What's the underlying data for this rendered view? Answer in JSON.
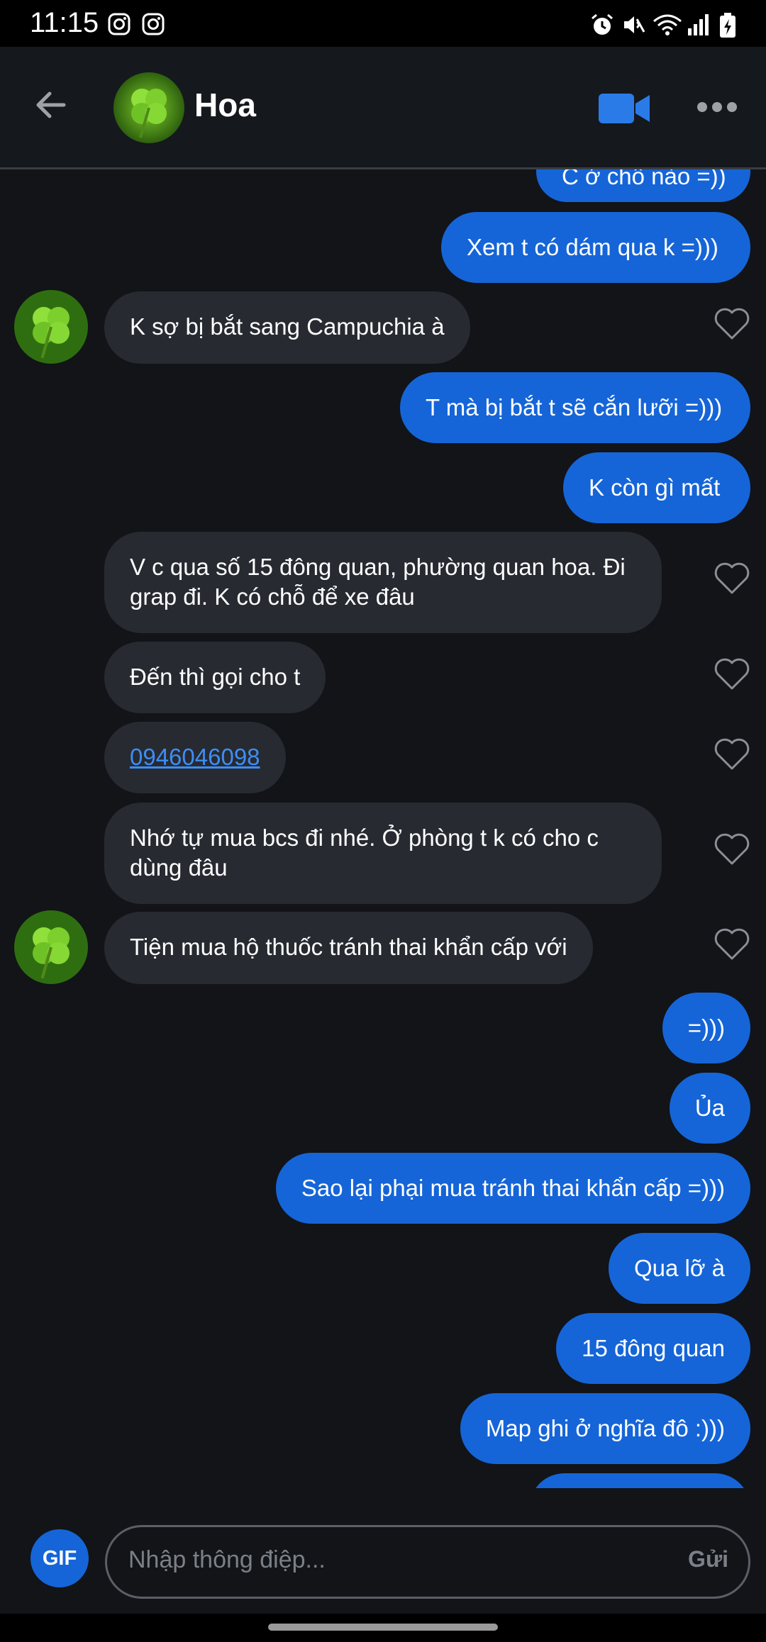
{
  "status_bar": {
    "time": "11:15"
  },
  "header": {
    "contact_name": "Hoa"
  },
  "messages": [
    {
      "dir": "out",
      "text": "C ở chỗ nào =))"
    },
    {
      "dir": "out",
      "text": "Xem t có dám qua k =)))"
    },
    {
      "dir": "in",
      "text": "K sợ bị bắt sang Campuchia à"
    },
    {
      "dir": "out",
      "text": "T mà bị bắt t sẽ cắn lưỡi =)))"
    },
    {
      "dir": "out",
      "text": "K còn gì mất"
    },
    {
      "dir": "in",
      "text": "V c qua số 15 đông quan, phường quan hoa. Đi grap đi. K có chỗ để xe đâu"
    },
    {
      "dir": "in",
      "text": "Đến thì gọi cho t"
    },
    {
      "dir": "in",
      "text": "0946046098"
    },
    {
      "dir": "in",
      "text": "Nhớ tự mua bcs đi nhé. Ở phòng t k có cho c dùng đâu"
    },
    {
      "dir": "in",
      "text": "Tiện mua hộ thuốc tránh thai khẩn cấp với"
    },
    {
      "dir": "out",
      "text": "=)))"
    },
    {
      "dir": "out",
      "text": "Ủa"
    },
    {
      "dir": "out",
      "text": "Sao lại phại mua tránh thai khẩn cấp =)))"
    },
    {
      "dir": "out",
      "text": "Qua lỡ à"
    },
    {
      "dir": "out",
      "text": "15 đông quan"
    },
    {
      "dir": "out",
      "text": "Map ghi ở nghĩa đô :)))"
    }
  ],
  "composer": {
    "gif_label": "GIF",
    "placeholder": "Nhập thông điệp...",
    "send_label": "Gửi"
  },
  "colors": {
    "outgoing_bubble": "#1565d8",
    "incoming_bubble": "#272a31",
    "link": "#3d8ef5",
    "background": "#121418"
  }
}
